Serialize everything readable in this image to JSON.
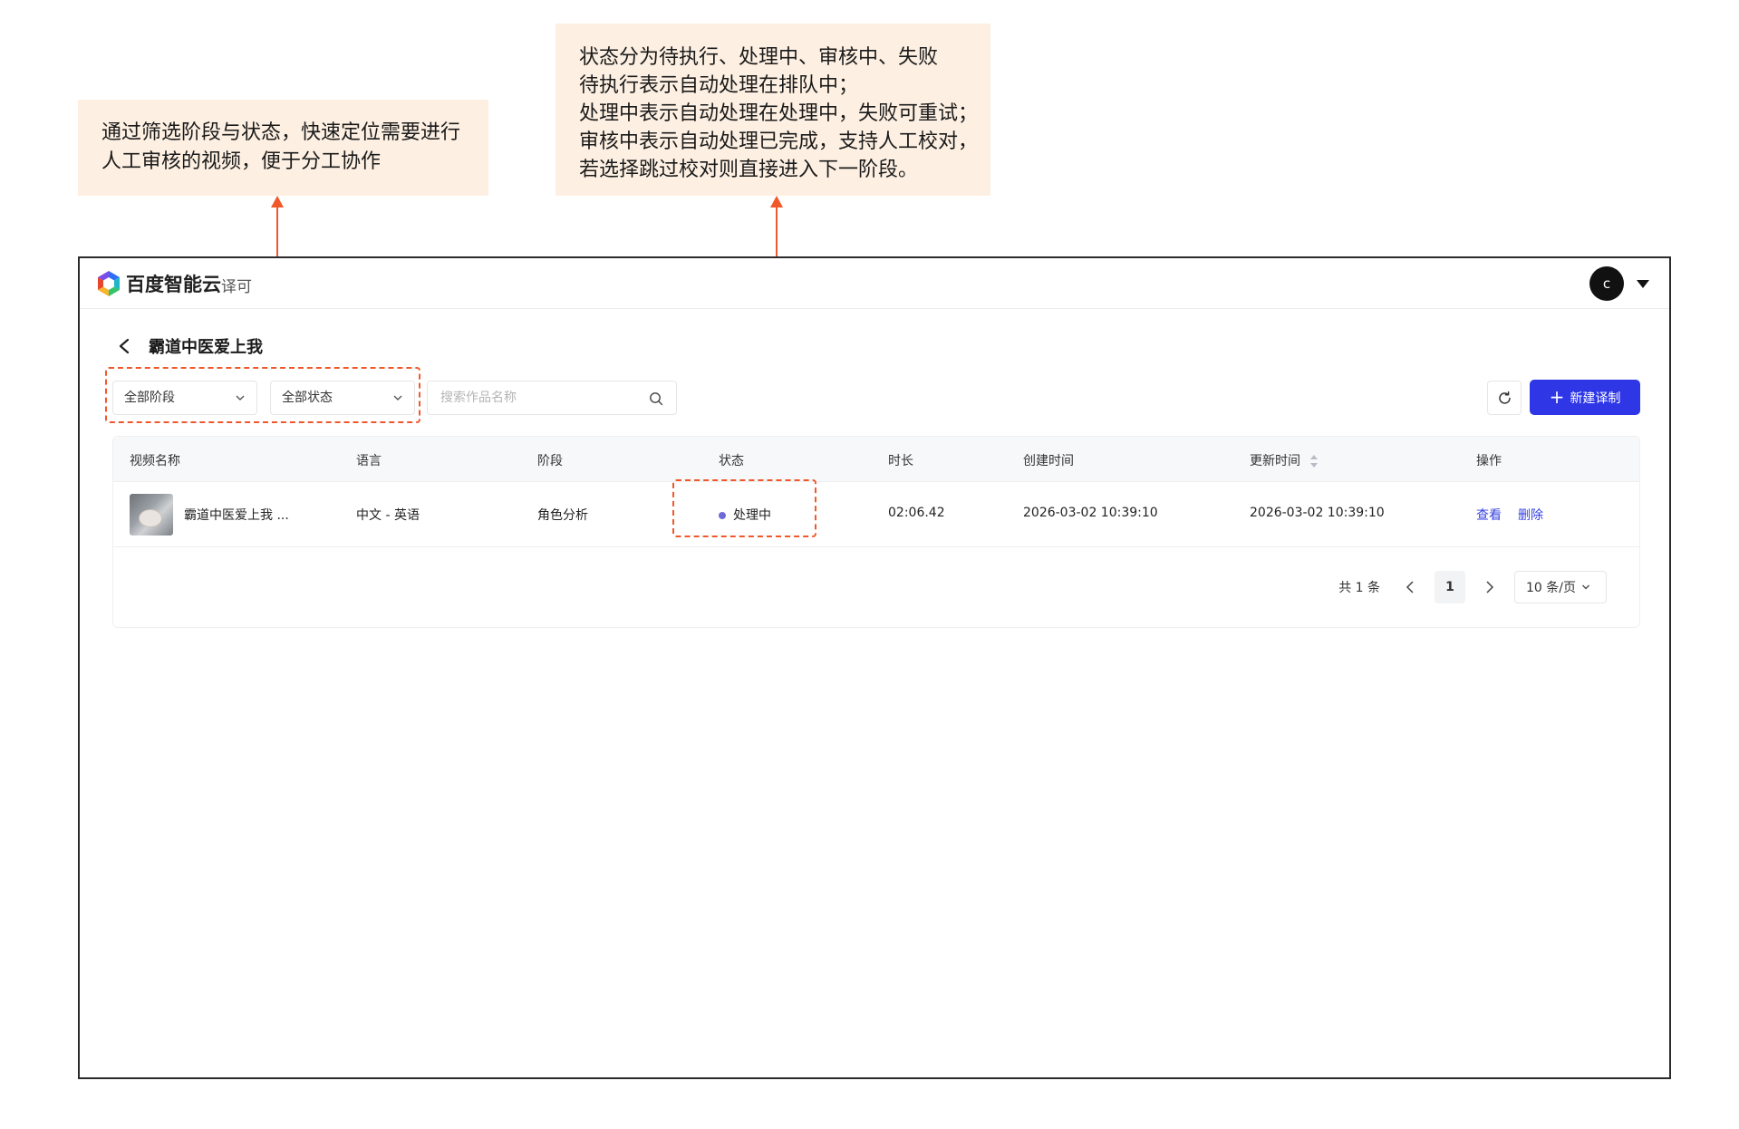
{
  "annotations": {
    "filter_note": [
      "通过筛选阶段与状态，快速定位需要进行",
      "人工审核的视频，便于分工协作"
    ],
    "status_note": [
      "状态分为待执行、处理中、审核中、失败",
      "待执行表示自动处理在排队中；",
      "处理中表示自动处理在处理中，失败可重试；",
      "审核中表示自动处理已完成，支持人工校对，",
      "若选择跳过校对则直接进入下一阶段。"
    ],
    "accent_color": "#f0582b"
  },
  "header": {
    "brand": "百度智能云",
    "product": "译可",
    "avatar_initial": "c"
  },
  "page": {
    "title": "霸道中医爱上我"
  },
  "toolbar": {
    "stage_select": "全部阶段",
    "status_select": "全部状态",
    "search_placeholder": "搜索作品名称",
    "new_button": "新建译制",
    "primary_color": "#2e36e6"
  },
  "table": {
    "columns": [
      "视频名称",
      "语言",
      "阶段",
      "状态",
      "时长",
      "创建时间",
      "更新时间",
      "操作"
    ],
    "rows": [
      {
        "name": "霸道中医爱上我 ...",
        "language": "中文 - 英语",
        "stage": "角色分析",
        "status": "处理中",
        "duration": "02:06.42",
        "created": "2026-03-02 10:39:10",
        "updated": "2026-03-02 10:39:10",
        "actions": [
          "查看",
          "删除"
        ]
      }
    ]
  },
  "pagination": {
    "total": "共 1 条",
    "current_page": "1",
    "page_size": "10 条/页"
  }
}
